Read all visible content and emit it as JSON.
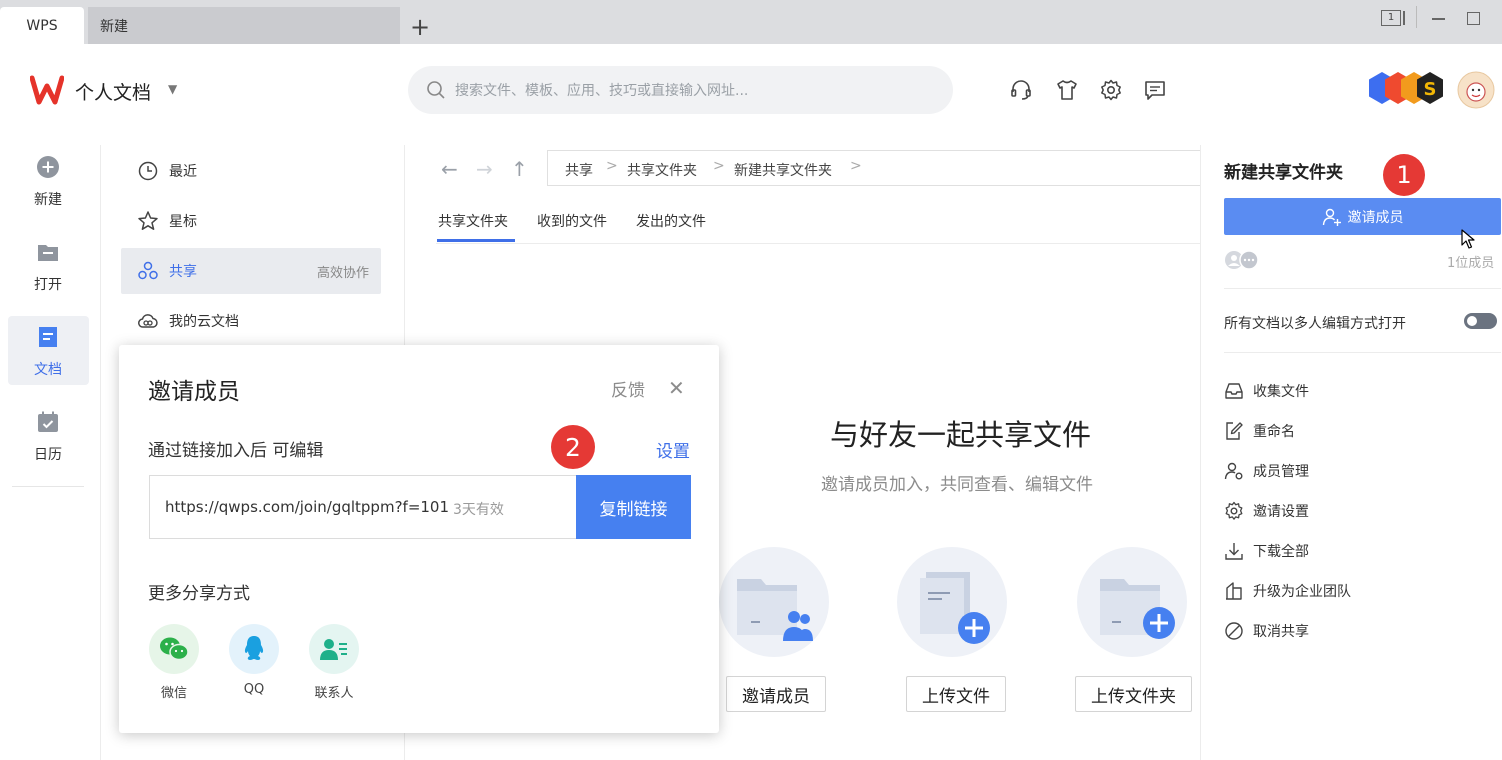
{
  "tabs": {
    "active": "WPS",
    "second": "新建",
    "add": "+"
  },
  "window": {
    "restore_badge": "1"
  },
  "header": {
    "title": "个人文档",
    "search_placeholder": "搜索文件、模板、应用、技巧或直接输入网址..."
  },
  "rail": {
    "new": "新建",
    "open": "打开",
    "docs": "文档",
    "calendar": "日历"
  },
  "nav": {
    "recent": "最近",
    "starred": "星标",
    "share": "共享",
    "share_extra": "高效协作",
    "cloud": "我的云文档"
  },
  "breadcrumb": [
    "共享",
    "共享文件夹",
    "新建共享文件夹"
  ],
  "subtabs": [
    "共享文件夹",
    "收到的文件",
    "发出的文件"
  ],
  "empty": {
    "title": "与好友一起共享文件",
    "subtitle": "邀请成员加入，共同查看、编辑文件",
    "buttons": [
      "邀请成员",
      "上传文件",
      "上传文件夹"
    ]
  },
  "panel": {
    "title": "新建共享文件夹",
    "badge": "1",
    "invite_button": "邀请成员",
    "member_count": "1位成员",
    "toggle_label": "所有文档以多人编辑方式打开",
    "actions": [
      "收集文件",
      "重命名",
      "成员管理",
      "邀请设置",
      "下载全部",
      "升级为企业团队",
      "取消共享"
    ]
  },
  "dialog": {
    "title": "邀请成员",
    "feedback": "反馈",
    "permission": "通过链接加入后 可编辑",
    "badge": "2",
    "settings": "设置",
    "link": "https://qwps.com/join/gqltppm?f=101",
    "validity": "3天有效",
    "copy_button": "复制链接",
    "more_share": "更多分享方式",
    "share_options": [
      "微信",
      "QQ",
      "联系人"
    ]
  },
  "colors": {
    "accent": "#4680f0",
    "badge": "#e53935",
    "wps_red": "#e5332a"
  }
}
